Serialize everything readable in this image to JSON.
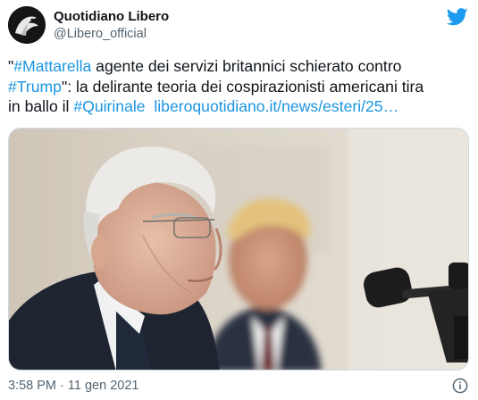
{
  "account": {
    "display_name": "Quotidiano Libero",
    "handle": "@Libero_official",
    "avatar_icon": "libero-logo",
    "brand_icon": "twitter-bird-icon",
    "brand_color": "#1d9bf0"
  },
  "tweet": {
    "line1": {
      "prefix": "\"",
      "hashtag": "#Mattarella",
      "rest": " agente dei servizi britannici schierato contro"
    },
    "line2": {
      "hashtag": "#Trump",
      "rest": "\": la delirante teoria dei cospirazionisti americani tira"
    },
    "line3": {
      "prefix": "in ballo il ",
      "hashtag": "#Quirinale",
      "gap": "  ",
      "link": "liberoquotidiano.it/news/esteri/25…"
    },
    "link_color": "#1b95e0"
  },
  "media": {
    "description_icon": "tweet-photo"
  },
  "footer": {
    "timestamp": "3:58 PM · 11 gen 2021",
    "info_icon": "info-icon"
  }
}
